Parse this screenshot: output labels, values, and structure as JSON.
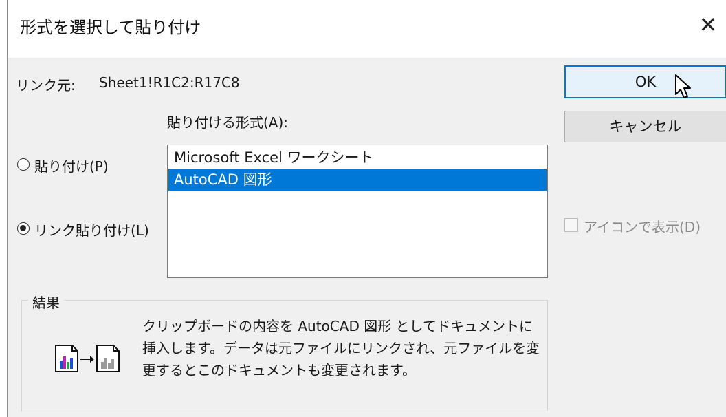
{
  "window": {
    "title": "形式を選択して貼り付け",
    "close_glyph": "✕"
  },
  "source": {
    "label": "リンク元:",
    "value": "Sheet1!R1C2:R17C8"
  },
  "format_list": {
    "label": "貼り付ける形式(A):",
    "items": [
      {
        "label": "Microsoft Excel ワークシート",
        "selected": false
      },
      {
        "label": "AutoCAD 図形",
        "selected": true
      }
    ]
  },
  "options": {
    "paste": {
      "label": "貼り付け(P)",
      "checked": false
    },
    "paste_link": {
      "label": "リンク貼り付け(L)",
      "checked": true
    }
  },
  "buttons": {
    "ok": "OK",
    "cancel": "キャンセル"
  },
  "display_as_icon": {
    "label": "アイコンで表示(D)",
    "checked": false,
    "enabled": false
  },
  "result": {
    "label": "結果",
    "text": "クリップボードの内容を AutoCAD 図形 としてドキュメントに挿入します。データは元ファイルにリンクされ、元ファイルを変更するとこのドキュメントも変更されます。",
    "icon": "paste-link-icon"
  },
  "colors": {
    "accent": "#0078d7",
    "selection": "#0078d7",
    "ok_bg": "#e5f1fb",
    "dialog_bg": "#f0f0f0"
  }
}
